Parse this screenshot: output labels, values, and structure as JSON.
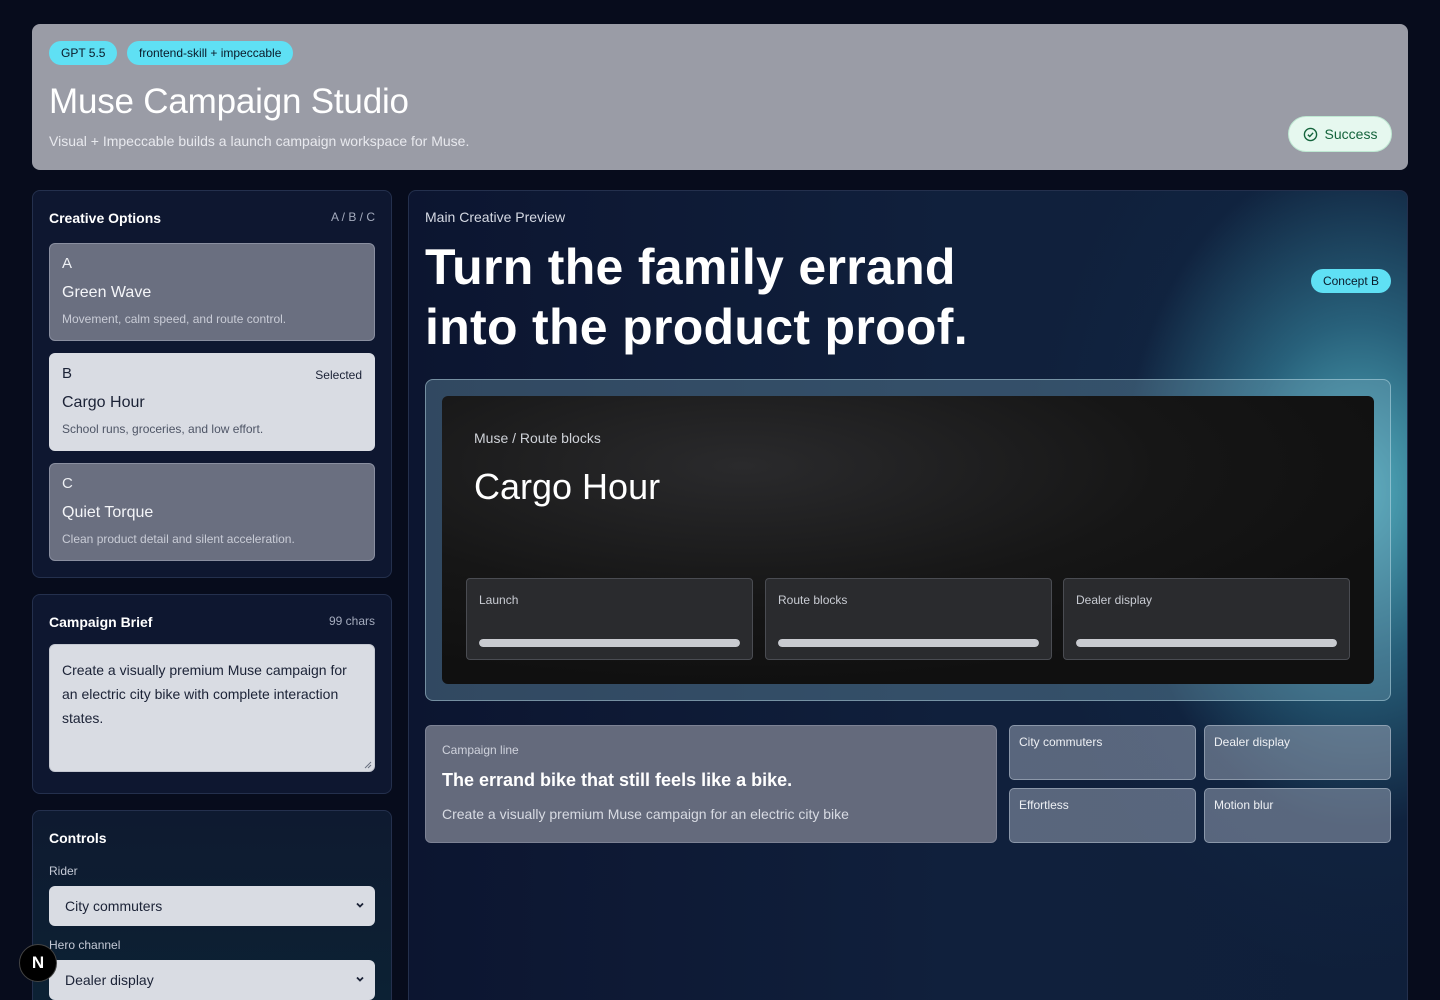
{
  "header": {
    "badges": [
      "GPT 5.5",
      "frontend-skill + impeccable"
    ],
    "title": "Muse Campaign Studio",
    "subtitle": "Visual + Impeccable builds a launch campaign workspace for Muse.",
    "status": "Success"
  },
  "options": {
    "title": "Creative Options",
    "meta": "A / B / C",
    "items": [
      {
        "letter": "A",
        "name": "Green Wave",
        "desc": "Movement, calm speed, and route control.",
        "badge": ""
      },
      {
        "letter": "B",
        "name": "Cargo Hour",
        "desc": "School runs, groceries, and low effort.",
        "badge": "Selected"
      },
      {
        "letter": "C",
        "name": "Quiet Torque",
        "desc": "Clean product detail and silent acceleration.",
        "badge": ""
      }
    ]
  },
  "brief": {
    "title": "Campaign Brief",
    "meta": "99 chars",
    "text": "Create a visually premium Muse campaign for an electric city bike with complete interaction states."
  },
  "controls": {
    "title": "Controls",
    "rider_label": "Rider",
    "rider_value": "City commuters",
    "channel_label": "Hero channel",
    "channel_value": "Dealer display"
  },
  "preview": {
    "label": "Main Creative Preview",
    "headline": "Turn the family errand into the product proof.",
    "concept": "Concept B",
    "crumbs": "Muse / Route blocks",
    "screen_title": "Cargo Hour",
    "metrics": [
      {
        "label": "Launch",
        "progress": 1.0
      },
      {
        "label": "Route blocks",
        "progress": 1.0
      },
      {
        "label": "Dealer display",
        "progress": 1.0
      }
    ],
    "campaign_label": "Campaign line",
    "campaign_line": "The errand bike that still feels like a bike.",
    "campaign_desc": "Create a visually premium Muse campaign for an electric city bike",
    "tags": [
      "City commuters",
      "Dealer display",
      "Effortless",
      "Motion blur"
    ]
  },
  "floating": {
    "n_label": "N"
  },
  "colors": {
    "accent": "#5fe0f4",
    "success": "#14643c",
    "background": "#070c1c"
  }
}
